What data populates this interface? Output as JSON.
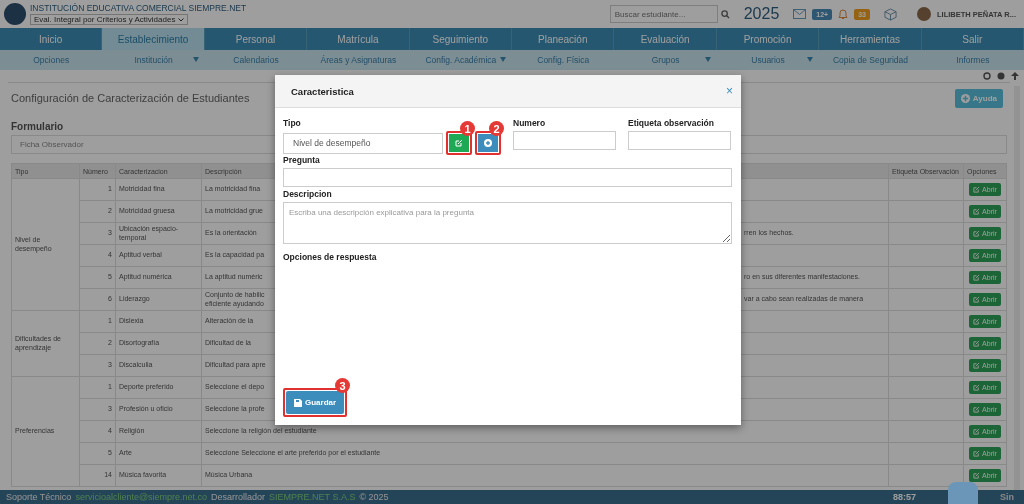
{
  "header": {
    "institution": "INSTITUCIÓN EDUCATIVA COMERCIAL SIEMPRE.NET",
    "period_select": "Eval. Integral por Criterios y Actividades",
    "search": {
      "placeholder": "Buscar estudiante..."
    },
    "year": "2025",
    "messages_badge": "12+",
    "notifications_badge": "33",
    "user": "LILIBETH PEÑATA R..."
  },
  "nav": [
    {
      "label": "Inicio",
      "selected": false
    },
    {
      "label": "Establecimiento",
      "selected": true
    },
    {
      "label": "Personal",
      "selected": false
    },
    {
      "label": "Matrícula",
      "selected": false
    },
    {
      "label": "Seguimiento",
      "selected": false
    },
    {
      "label": "Planeación",
      "selected": false
    },
    {
      "label": "Evaluación",
      "selected": false
    },
    {
      "label": "Promoción",
      "selected": false
    },
    {
      "label": "Herramientas",
      "selected": false
    },
    {
      "label": "Salir",
      "selected": false
    }
  ],
  "subnav": [
    {
      "label": "Opciones",
      "dropdown": false
    },
    {
      "label": "Institución",
      "dropdown": true
    },
    {
      "label": "Calendarios",
      "dropdown": false
    },
    {
      "label": "Áreas y Asignaturas",
      "dropdown": false
    },
    {
      "label": "Config. Académica",
      "dropdown": true
    },
    {
      "label": "Config. Física",
      "dropdown": false
    },
    {
      "label": "Grupos",
      "dropdown": true
    },
    {
      "label": "Usuarios",
      "dropdown": true
    },
    {
      "label": "Copia de Seguridad",
      "dropdown": false
    },
    {
      "label": "Informes",
      "dropdown": false
    }
  ],
  "page": {
    "title": "Configuración de Caracterización de Estudiantes",
    "help_button": "Ayuda",
    "form_label": "Formulario",
    "form_value": "Ficha Observador"
  },
  "table": {
    "columns": [
      "Tipo",
      "Número",
      "Caracterizacion",
      "Descripción",
      "Etiqueta Observación",
      "Opciones"
    ],
    "groups": [
      {
        "type": "Nivel de desempeño",
        "rows": [
          {
            "number": "1",
            "name": "Motricidad fina",
            "description": "La motricidad fina",
            "description_tail": "",
            "action": "Abrir"
          },
          {
            "number": "2",
            "name": "Motricidad gruesa",
            "description": "La motricidad grue",
            "description_tail": "",
            "action": "Abrir"
          },
          {
            "number": "3",
            "name": "Ubicación espacio-temporal",
            "description": "Es la orientación",
            "description_tail": "rren los hechos.",
            "action": "Abrir"
          },
          {
            "number": "4",
            "name": "Aptitud verbal",
            "description": "Es la capacidad pa",
            "description_tail": "",
            "action": "Abrir"
          },
          {
            "number": "5",
            "name": "Aptitud numérica",
            "description": "La aptitud numéric",
            "description_tail": "ro en sus diferentes manifestaciones.",
            "action": "Abrir"
          },
          {
            "number": "6",
            "name": "Liderazgo",
            "description": "Conjunto de habilic\neficiente ayudando",
            "description_tail": "var a cabo sean realizadas de manera",
            "action": "Abrir"
          }
        ]
      },
      {
        "type": "Dificultades de aprendizaje",
        "rows": [
          {
            "number": "1",
            "name": "Dislexia",
            "description": "Alteración de la",
            "description_tail": "",
            "action": "Abrir"
          },
          {
            "number": "2",
            "name": "Disortografía",
            "description": "Dificultad de la",
            "description_tail": "",
            "action": "Abrir"
          },
          {
            "number": "3",
            "name": "Discalculia",
            "description": "Dificultad para apre",
            "description_tail": "",
            "action": "Abrir"
          }
        ]
      },
      {
        "type": "Preferencias",
        "rows": [
          {
            "number": "1",
            "name": "Deporte preferido",
            "description": "Seleccione el depo",
            "description_tail": "",
            "action": "Abrir"
          },
          {
            "number": "3",
            "name": "Profesión u oficio",
            "description": "Seleccione la profe",
            "description_tail": "",
            "action": "Abrir"
          },
          {
            "number": "4",
            "name": "Religión",
            "description": "Seleccione la religión del estudiante",
            "description_tail": "",
            "action": "Abrir"
          },
          {
            "number": "5",
            "name": "Arte",
            "description": "Seleccione Seleccione el arte preferido por el estudiante",
            "description_tail": "",
            "action": "Abrir"
          },
          {
            "number": "14",
            "name": "Música favorita",
            "description": "Música Urbana",
            "description_tail": "",
            "action": "Abrir"
          }
        ]
      }
    ]
  },
  "modal": {
    "title": "Caracteristica",
    "close": "×",
    "tipo_label": "Tipo",
    "tipo_value": "Nivel de desempeño",
    "edit_marker": "1",
    "add_marker": "2",
    "numero_label": "Numero",
    "etiqueta_label": "Etiqueta observación",
    "pregunta_label": "Pregunta",
    "descripcion_label": "Descripcion",
    "descripcion_placeholder": "Escriba una descripción explicativa para la pregunta",
    "opciones_label": "Opciones de respuesta",
    "save_button": "Guardar",
    "save_marker": "3"
  },
  "footer": {
    "support_label": "Soporte Técnico",
    "support_email": "servicioalcliente@siempre.net.co",
    "developer_label": "Desarrollador",
    "developer_link": "SIEMPRE.NET S.A.S",
    "copyright": "© 2025",
    "timer": "88:57",
    "brand": "Sin"
  }
}
